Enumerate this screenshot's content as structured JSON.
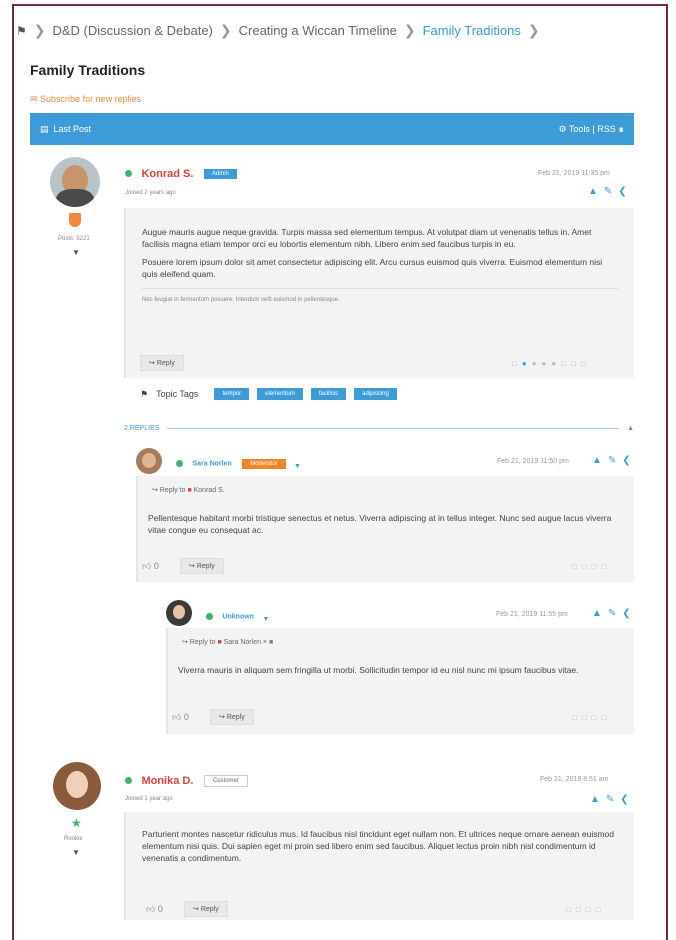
{
  "breadcrumb": {
    "items": [
      "D&D (Discussion & Debate)",
      "Creating a Wiccan Timeline",
      "Family Traditions"
    ]
  },
  "page_title": "Family Traditions",
  "subscribe_label": "Subscribe for new replies",
  "toolbar": {
    "last_post": "Last Post",
    "right": "Tools | RSS"
  },
  "topic": {
    "author": "Konrad S.",
    "role": "Admin",
    "meta": "Joined 2 years ago",
    "posts": "Posts: 5221",
    "date": "Feb 21, 2019 11:35 pm",
    "para1": "Augue mauris augue neque gravida. Turpis massa sed elementum tempus. At volutpat diam ut venenatis tellus in. Amet facilisis magna etiam tempor orci eu lobortis elementum nibh. Libero enim sed faucibus turpis in eu.",
    "para2": "Posuere lorem ipsum dolor sit amet consectetur adipiscing elit. Arcu cursus euismod quis viverra. Euismod elementum nisi quis eleifend quam.",
    "signature": "Nec feugiat in fermentum posuere. Interdum velit euismod in pellentesque.",
    "reply_label": "Reply"
  },
  "tags_label": "Topic Tags",
  "tags": [
    "tempor",
    "elementum",
    "facilisis",
    "adipiscing"
  ],
  "replies_label": "2 REPLIES",
  "replies": [
    {
      "author": "Sara Norlen",
      "role": "Moderator",
      "date": "Feb 21, 2019 11:50 pm",
      "reply_to": "Konrad S.",
      "text": "Pellentesque habitant morbi tristique senectus et netus. Viverra adipiscing at in tellus integer. Nunc sed augue lacus viverra vitae congue eu consequat ac.",
      "likes": "0",
      "reply_label": "Reply"
    },
    {
      "author": "Unknown",
      "date": "Feb 21, 2019 11:55 pm",
      "reply_to": "Sara Norlen",
      "text": "Viverra mauris in aliquam sem fringilla ut morbi. Sollicitudin tempor id eu nisl nunc mi ipsum faucibus vitae.",
      "likes": "0",
      "reply_label": "Reply"
    }
  ],
  "second_post": {
    "author": "Monika D.",
    "role": "Customer",
    "meta": "Joined 1 year ago",
    "rank": "Rookie",
    "date": "Feb 21, 2019 8:51 am",
    "text": "Parturient montes nascetur ridiculus mus. Id faucibus nisl tincidunt eget nullam non. Et ultrices neque ornare aenean euismod elementum nisi quis. Dui sapien eget mi proin sed libero enim sed faucibus. Aliquet lectus proin nibh nisl condimentum id venenatis a condimentum.",
    "likes": "0",
    "reply_label": "Reply"
  },
  "colors": {
    "accent": "#3d9bd8",
    "admin_name": "#d9423a",
    "moderator_badge": "#f0852a",
    "online": "#3cb56b",
    "frame": "#7a2a3e"
  }
}
